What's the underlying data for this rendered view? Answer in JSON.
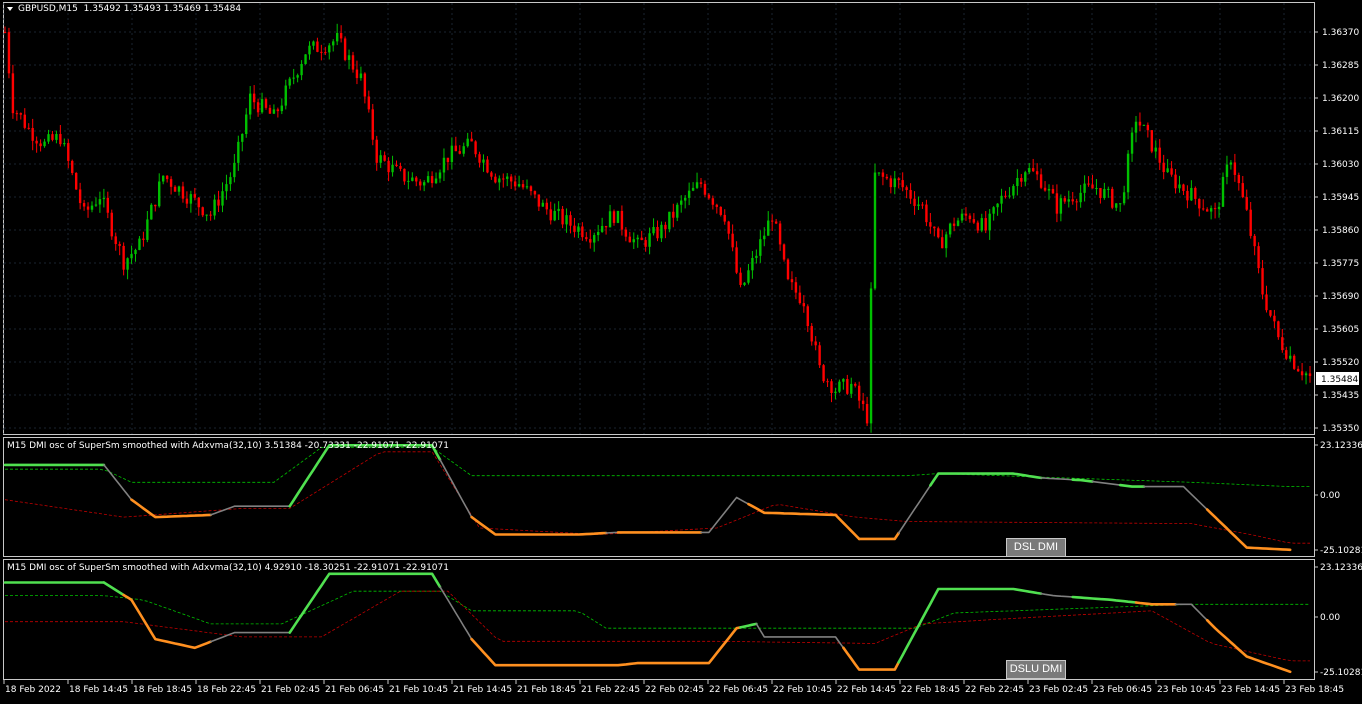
{
  "colors": {
    "background": "#000000",
    "frame": "#c8c8c8",
    "grid": "#1a2530",
    "bull": "#00c000",
    "bear": "#ff0000",
    "osc_up": "#50e050",
    "osc_down": "#ff9020",
    "osc_flat": "#808080",
    "level_up": "#00c000",
    "level_down": "#c00000",
    "button_bg": "#7a7a7a"
  },
  "main": {
    "header": {
      "symbol_tf": "GBPUSD,M15",
      "ohlc": "1.35492 1.35493 1.35469 1.35484"
    },
    "collapse_icon": "triangle-down-icon",
    "price_ticks": [
      "1.36370",
      "1.36285",
      "1.36200",
      "1.36115",
      "1.36030",
      "1.35945",
      "1.35860",
      "1.35775",
      "1.35690",
      "1.35605",
      "1.35520",
      "1.35435",
      "1.35350"
    ],
    "current_price": "1.35484"
  },
  "x_ticks": [
    "18 Feb 2022",
    "18 Feb 14:45",
    "18 Feb 18:45",
    "18 Feb 22:45",
    "21 Feb 02:45",
    "21 Feb 06:45",
    "21 Feb 10:45",
    "21 Feb 14:45",
    "21 Feb 18:45",
    "21 Feb 22:45",
    "22 Feb 02:45",
    "22 Feb 06:45",
    "22 Feb 10:45",
    "22 Feb 14:45",
    "22 Feb 18:45",
    "22 Feb 22:45",
    "23 Feb 02:45",
    "23 Feb 06:45",
    "23 Feb 10:45",
    "23 Feb 14:45",
    "23 Feb 18:45"
  ],
  "panels": [
    {
      "title": "M15 DMI osc of SuperSm smoothed with Adxvma(32,10) 3.51384 -20.73331 -22.91071 -22.91071",
      "scale_top": "23.12336",
      "scale_mid": "0.00",
      "scale_bot": "-25.10281",
      "button": "DSL DMI"
    },
    {
      "title": "M15 DMI osc of SuperSm smoothed with Adxvma(32,10) 4.92910 -18.30251 -22.91071 -22.91071",
      "scale_top": "23.12336",
      "scale_mid": "0.00",
      "scale_bot": "-25.10281",
      "button": "DSLU DMI"
    }
  ],
  "chart_data": [
    {
      "type": "candlestick",
      "title": "GBPUSD,M15",
      "ylim": [
        1.3535,
        1.3645
      ],
      "anchors": [
        [
          0,
          1.3637
        ],
        [
          2,
          1.3618
        ],
        [
          6,
          1.3612
        ],
        [
          10,
          1.3608
        ],
        [
          14,
          1.361
        ],
        [
          20,
          1.359
        ],
        [
          24,
          1.3595
        ],
        [
          30,
          1.3578
        ],
        [
          34,
          1.3582
        ],
        [
          40,
          1.36
        ],
        [
          46,
          1.3595
        ],
        [
          52,
          1.359
        ],
        [
          58,
          1.3602
        ],
        [
          62,
          1.362
        ],
        [
          68,
          1.3615
        ],
        [
          76,
          1.3632
        ],
        [
          84,
          1.3635
        ],
        [
          90,
          1.3625
        ],
        [
          94,
          1.3605
        ],
        [
          100,
          1.36
        ],
        [
          106,
          1.3598
        ],
        [
          112,
          1.3605
        ],
        [
          118,
          1.3608
        ],
        [
          124,
          1.36
        ],
        [
          130,
          1.3598
        ],
        [
          136,
          1.3592
        ],
        [
          142,
          1.3588
        ],
        [
          148,
          1.3585
        ],
        [
          154,
          1.359
        ],
        [
          160,
          1.3582
        ],
        [
          166,
          1.3586
        ],
        [
          172,
          1.3594
        ],
        [
          176,
          1.3598
        ],
        [
          182,
          1.359
        ],
        [
          186,
          1.357
        ],
        [
          190,
          1.358
        ],
        [
          194,
          1.359
        ],
        [
          198,
          1.3572
        ],
        [
          202,
          1.3568
        ],
        [
          206,
          1.355
        ],
        [
          210,
          1.3545
        ],
        [
          214,
          1.3546
        ],
        [
          218,
          1.3538
        ],
        [
          220,
          1.36
        ],
        [
          226,
          1.3598
        ],
        [
          232,
          1.3592
        ],
        [
          236,
          1.3582
        ],
        [
          240,
          1.3588
        ],
        [
          244,
          1.359
        ],
        [
          248,
          1.3586
        ],
        [
          252,
          1.3594
        ],
        [
          258,
          1.3602
        ],
        [
          262,
          1.3599
        ],
        [
          266,
          1.3592
        ],
        [
          270,
          1.3595
        ],
        [
          276,
          1.3597
        ],
        [
          282,
          1.3592
        ],
        [
          286,
          1.3615
        ],
        [
          290,
          1.3608
        ],
        [
          294,
          1.36
        ],
        [
          300,
          1.3595
        ],
        [
          306,
          1.359
        ],
        [
          310,
          1.3605
        ],
        [
          314,
          1.359
        ],
        [
          318,
          1.357
        ],
        [
          322,
          1.3558
        ],
        [
          326,
          1.3552
        ],
        [
          330,
          1.3548
        ]
      ]
    },
    {
      "type": "line",
      "title": "DSL DMI",
      "ylim": [
        -25.10281,
        23.12336
      ],
      "osc": [
        [
          0,
          14
        ],
        [
          25,
          14
        ],
        [
          32,
          -2
        ],
        [
          38,
          -10
        ],
        [
          52,
          -9
        ],
        [
          58,
          -5
        ],
        [
          72,
          -5
        ],
        [
          82,
          23
        ],
        [
          108,
          23
        ],
        [
          118,
          -10
        ],
        [
          124,
          -18
        ],
        [
          145,
          -18
        ],
        [
          155,
          -17
        ],
        [
          178,
          -17
        ],
        [
          185,
          -1
        ],
        [
          192,
          -8
        ],
        [
          210,
          -9
        ],
        [
          216,
          -20
        ],
        [
          225,
          -20
        ],
        [
          236,
          10
        ],
        [
          255,
          10
        ],
        [
          262,
          8
        ],
        [
          272,
          7
        ],
        [
          285,
          4
        ],
        [
          298,
          4
        ],
        [
          306,
          -10
        ],
        [
          314,
          -24
        ],
        [
          325,
          -25
        ]
      ],
      "dsl_up": [
        [
          0,
          12
        ],
        [
          25,
          12
        ],
        [
          32,
          6
        ],
        [
          68,
          6
        ],
        [
          80,
          22
        ],
        [
          108,
          22
        ],
        [
          118,
          9
        ],
        [
          228,
          9
        ],
        [
          236,
          10
        ],
        [
          300,
          6
        ],
        [
          325,
          4
        ]
      ],
      "dsl_down": [
        [
          0,
          -2
        ],
        [
          30,
          -10
        ],
        [
          60,
          -6
        ],
        [
          72,
          -6
        ],
        [
          95,
          20
        ],
        [
          108,
          20
        ],
        [
          120,
          -15
        ],
        [
          150,
          -18
        ],
        [
          180,
          -15
        ],
        [
          195,
          -4
        ],
        [
          215,
          -10
        ],
        [
          228,
          -12
        ],
        [
          300,
          -13
        ],
        [
          315,
          -18
        ],
        [
          325,
          -22
        ]
      ],
      "osc_state": [
        [
          0,
          "up"
        ],
        [
          25,
          "flat"
        ],
        [
          32,
          "down"
        ],
        [
          52,
          "flat"
        ],
        [
          72,
          "up"
        ],
        [
          110,
          "flat"
        ],
        [
          118,
          "down"
        ],
        [
          152,
          "flat"
        ],
        [
          155,
          "down"
        ],
        [
          176,
          "flat"
        ],
        [
          188,
          "down"
        ],
        [
          216,
          "down"
        ],
        [
          226,
          "flat"
        ],
        [
          234,
          "up"
        ],
        [
          262,
          "flat"
        ],
        [
          270,
          "up"
        ],
        [
          275,
          "flat"
        ],
        [
          282,
          "up"
        ],
        [
          288,
          "flat"
        ],
        [
          304,
          "down"
        ]
      ]
    },
    {
      "type": "line",
      "title": "DSLU DMI",
      "ylim": [
        -25.10281,
        23.12336
      ],
      "osc": [
        [
          0,
          16
        ],
        [
          25,
          16
        ],
        [
          32,
          8
        ],
        [
          38,
          -10
        ],
        [
          48,
          -14
        ],
        [
          58,
          -7
        ],
        [
          72,
          -7
        ],
        [
          82,
          20
        ],
        [
          108,
          20
        ],
        [
          118,
          -10
        ],
        [
          124,
          -22
        ],
        [
          155,
          -22
        ],
        [
          160,
          -21
        ],
        [
          178,
          -21
        ],
        [
          185,
          -5
        ],
        [
          190,
          -3
        ],
        [
          192,
          -9
        ],
        [
          210,
          -9
        ],
        [
          216,
          -24
        ],
        [
          225,
          -24
        ],
        [
          236,
          13
        ],
        [
          255,
          13
        ],
        [
          265,
          10
        ],
        [
          280,
          8
        ],
        [
          290,
          6
        ],
        [
          300,
          6
        ],
        [
          306,
          -5
        ],
        [
          314,
          -18
        ],
        [
          325,
          -25
        ]
      ],
      "dsl_up": [
        [
          0,
          10
        ],
        [
          25,
          10
        ],
        [
          35,
          8
        ],
        [
          52,
          -3
        ],
        [
          70,
          -3
        ],
        [
          88,
          12
        ],
        [
          110,
          12
        ],
        [
          118,
          3
        ],
        [
          145,
          3
        ],
        [
          152,
          -5
        ],
        [
          230,
          -5
        ],
        [
          240,
          2
        ],
        [
          300,
          6
        ],
        [
          325,
          6
        ]
      ],
      "dsl_down": [
        [
          0,
          -2
        ],
        [
          30,
          -2
        ],
        [
          60,
          -9
        ],
        [
          80,
          -9
        ],
        [
          100,
          12
        ],
        [
          112,
          12
        ],
        [
          125,
          -11
        ],
        [
          180,
          -11
        ],
        [
          220,
          -12
        ],
        [
          232,
          -3
        ],
        [
          250,
          -1
        ],
        [
          290,
          3
        ],
        [
          305,
          -12
        ],
        [
          325,
          -20
        ]
      ],
      "osc_state": [
        [
          0,
          "up"
        ],
        [
          25,
          "up"
        ],
        [
          30,
          "down"
        ],
        [
          52,
          "flat"
        ],
        [
          72,
          "up"
        ],
        [
          110,
          "flat"
        ],
        [
          118,
          "down"
        ],
        [
          186,
          "up"
        ],
        [
          190,
          "flat"
        ],
        [
          212,
          "down"
        ],
        [
          226,
          "up"
        ],
        [
          262,
          "flat"
        ],
        [
          270,
          "up"
        ],
        [
          286,
          "down"
        ],
        [
          296,
          "flat"
        ],
        [
          304,
          "down"
        ]
      ]
    }
  ]
}
